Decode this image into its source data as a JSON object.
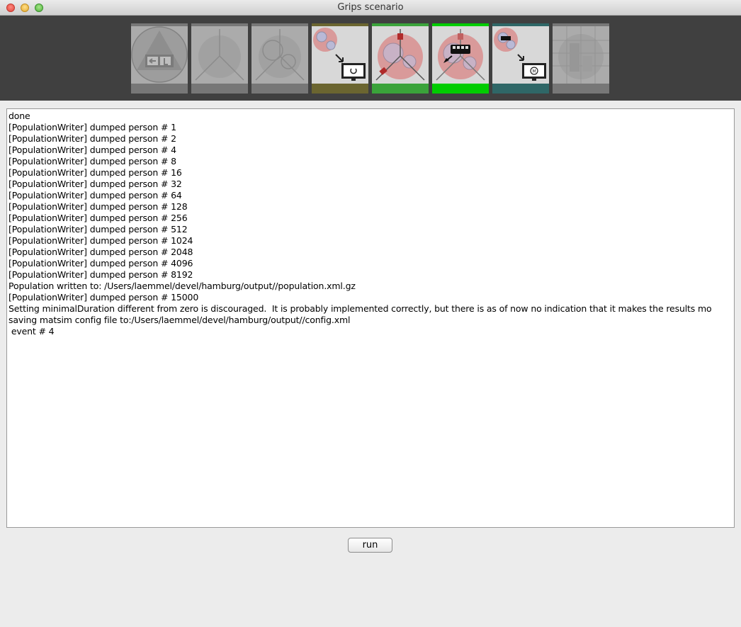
{
  "window": {
    "title": "Grips scenario"
  },
  "toolbar": {
    "steps": [
      {
        "icon": "evacuation-exit-icon",
        "state": "disabled",
        "bar_color": "#8a8a8a"
      },
      {
        "icon": "triangle-lines-icon",
        "state": "disabled",
        "bar_color": "#8a8a8a"
      },
      {
        "icon": "circles-lines-icon",
        "state": "disabled",
        "bar_color": "#8a8a8a"
      },
      {
        "icon": "network-to-monitor-icon",
        "state": "done",
        "bar_color": "#6b6530"
      },
      {
        "icon": "population-nodes-icon",
        "state": "done",
        "bar_color": "#3aa33a"
      },
      {
        "icon": "bus-scenario-icon",
        "state": "active",
        "bar_color": "#00cc00"
      },
      {
        "icon": "matsim-monitor-icon",
        "state": "available",
        "bar_color": "#2f6767"
      },
      {
        "icon": "grid-map-icon",
        "state": "disabled",
        "bar_color": "#8a8a8a"
      }
    ]
  },
  "log": {
    "lines": [
      "done",
      "[PopulationWriter] dumped person # 1",
      "[PopulationWriter] dumped person # 2",
      "[PopulationWriter] dumped person # 4",
      "[PopulationWriter] dumped person # 8",
      "[PopulationWriter] dumped person # 16",
      "[PopulationWriter] dumped person # 32",
      "[PopulationWriter] dumped person # 64",
      "[PopulationWriter] dumped person # 128",
      "[PopulationWriter] dumped person # 256",
      "[PopulationWriter] dumped person # 512",
      "[PopulationWriter] dumped person # 1024",
      "[PopulationWriter] dumped person # 2048",
      "[PopulationWriter] dumped person # 4096",
      "[PopulationWriter] dumped person # 8192",
      "Population written to: /Users/laemmel/devel/hamburg/output//population.xml.gz",
      "[PopulationWriter] dumped person # 15000",
      "Setting minimalDuration different from zero is discouraged.  It is probably implemented correctly, but there is as of now no indication that it makes the results mo",
      "saving matsim config file to:/Users/laemmel/devel/hamburg/output//config.xml",
      " event # 4"
    ]
  },
  "buttons": {
    "run_label": "run"
  }
}
